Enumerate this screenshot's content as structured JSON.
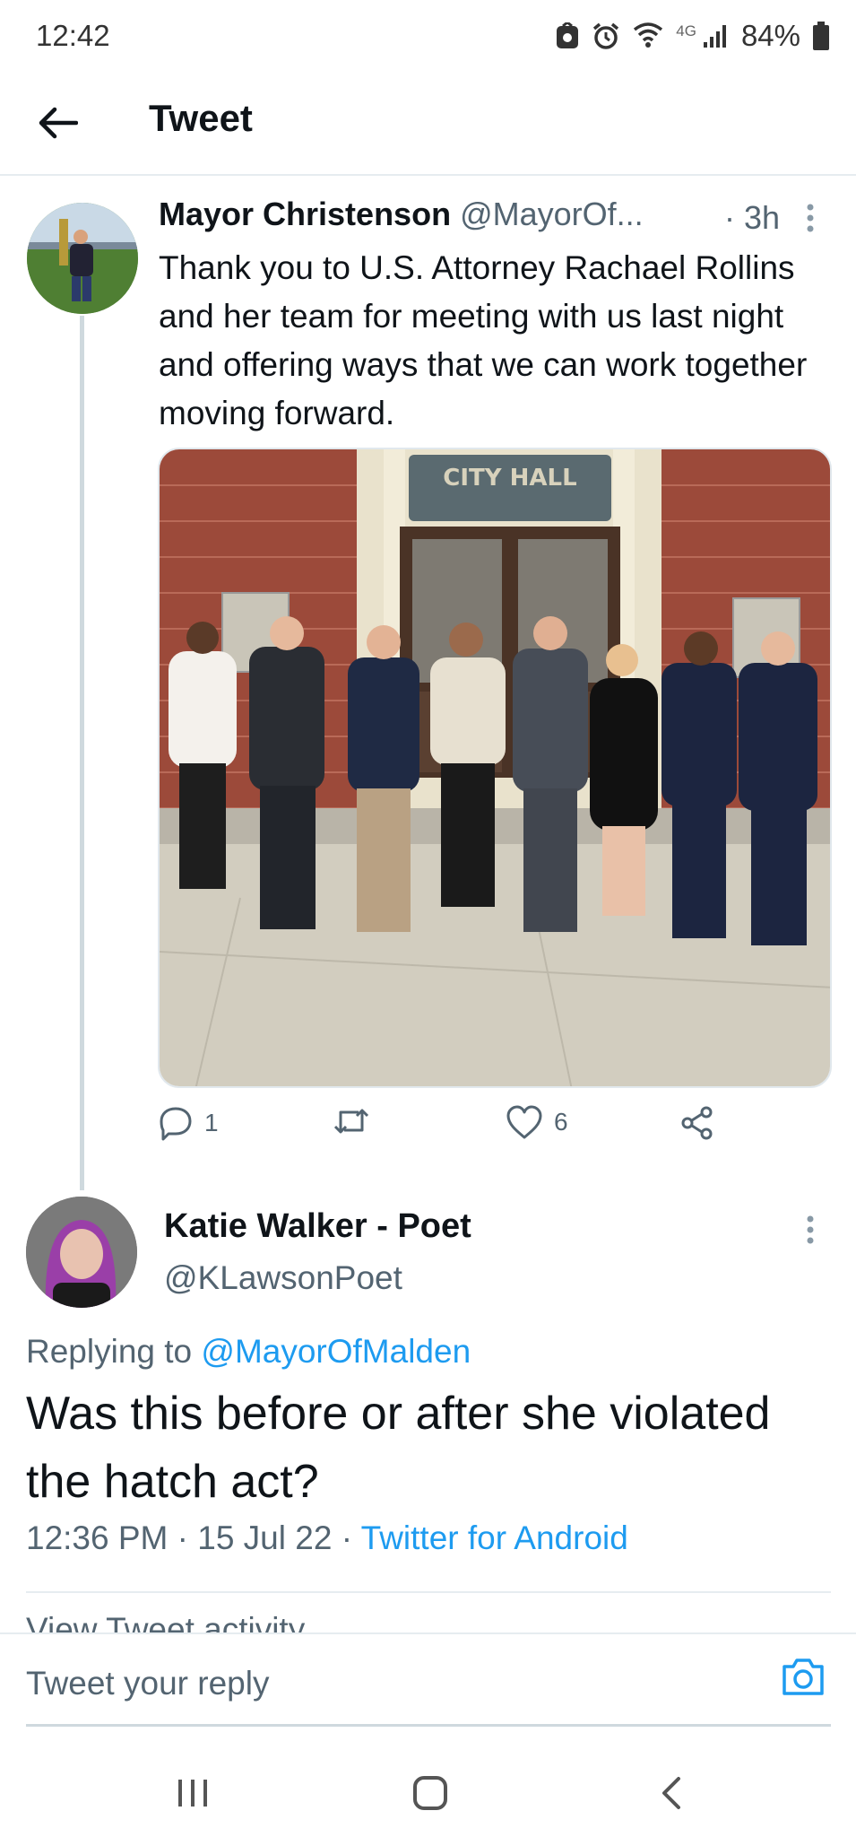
{
  "status_bar": {
    "time": "12:42",
    "network_label": "4G",
    "battery": "84%",
    "icons": [
      "smart-lock-icon",
      "alarm-icon",
      "wifi-icon",
      "signal-icon",
      "battery-icon"
    ]
  },
  "header": {
    "back_icon": "arrow-left-icon",
    "title": "Tweet"
  },
  "tweet": {
    "author_name": "Mayor Christenson",
    "author_handle": "@MayorOf...",
    "time": "· 3h",
    "text": "Thank you to U.S. Attorney Rachael Rollins and her team for meeting with us last night and offering ways that we can work together moving forward.",
    "photo_sign": "CITY HALL",
    "actions": {
      "reply_count": "1",
      "retweet_count": "",
      "like_count": "6"
    }
  },
  "reply": {
    "author_name": "Katie Walker - Poet",
    "author_handle": "@KLawsonPoet",
    "replying_prefix": "Replying to",
    "replying_mention": "@MayorOfMalden",
    "text": "Was this before or after she violated the hatch act?",
    "timestamp": "12:36 PM · 15 Jul 22 · ",
    "source": "Twitter for Android",
    "activity_link": "View Tweet activity"
  },
  "compose": {
    "placeholder": "Tweet your reply"
  },
  "colors": {
    "accent": "#1d9bf0",
    "text_primary": "#0f1419",
    "text_secondary": "#536471",
    "divider": "#e6ecf0"
  }
}
